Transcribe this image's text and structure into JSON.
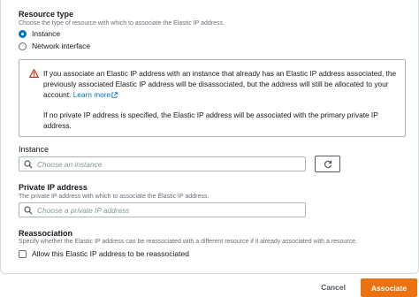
{
  "resource_type": {
    "title": "Resource type",
    "description": "Choose the type of resource with which to associate the Elastic IP address.",
    "options": [
      {
        "label": "Instance",
        "selected": true
      },
      {
        "label": "Network interface",
        "selected": false
      }
    ]
  },
  "warning": {
    "text": "If you associate an Elastic IP address with an instance that already has an Elastic IP address associated, the previously associated Elastic IP address will be disassociated, but the address will still be allocated to your account.",
    "link_label": "Learn more",
    "note": "If no private IP address is specified, the Elastic IP address will be associated with the primary private IP address.",
    "icon": "warning-triangle-icon",
    "icon_color": "#d13212"
  },
  "instance": {
    "label": "Instance",
    "placeholder": "Choose an instance",
    "value": ""
  },
  "private_ip": {
    "label": "Private IP address",
    "description": "The private IP address with which to associate the Elastic IP address.",
    "placeholder": "Choose a private IP address",
    "value": ""
  },
  "reassociation": {
    "title": "Reassociation",
    "description": "Specify whether the Elastic IP address can be reassociated with a different resource if it already associated with a resource.",
    "checkbox_label": "Allow this Elastic IP address to be reassociated",
    "checked": false
  },
  "actions": {
    "cancel_label": "Cancel",
    "associate_label": "Associate",
    "primary_color": "#ec7211"
  }
}
